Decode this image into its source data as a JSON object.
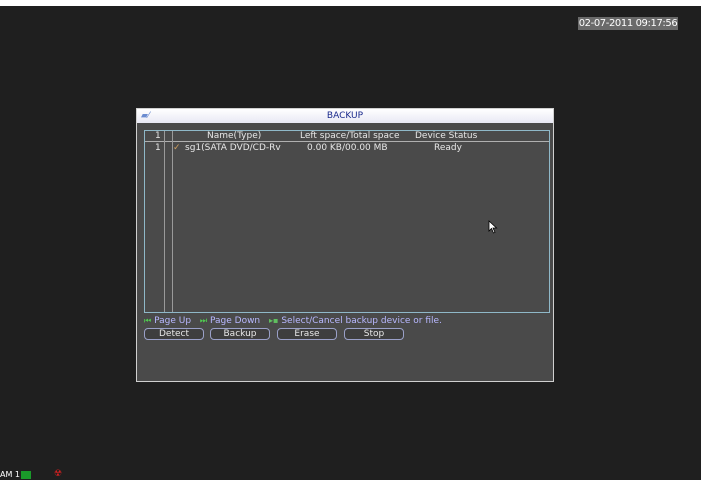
{
  "screen": {
    "datetime": "02-07-2011 09:17:56",
    "channel_label": "AM 1"
  },
  "dialog": {
    "title": "BACKUP",
    "table": {
      "headers": {
        "index": "1",
        "name": "Name(Type)",
        "space": "Left space/Total space",
        "status": "Device Status"
      },
      "rows": [
        {
          "index": "1",
          "name": "sg1(SATA DVD/CD-Rv",
          "space": "0.00 KB/00.00 MB",
          "status": "Ready"
        }
      ]
    },
    "hints": {
      "page_up": "Page Up",
      "page_down": "Page Down",
      "select": "Select/Cancel backup device or file."
    },
    "buttons": {
      "detect": "Detect",
      "backup": "Backup",
      "erase": "Erase",
      "stop": "Stop"
    }
  },
  "colors": {
    "background": "#1f1f1f",
    "dialog_bg": "#4a4a4a",
    "title_text": "#1a2a8c",
    "hint_text": "#b8b8ff",
    "status_green": "#1a9a2a",
    "alarm_red": "#d02020"
  },
  "icons": {
    "title": "backup-window-icon",
    "row_check": "checkmark-icon",
    "cursor": "mouse-pointer-icon",
    "alarm": "alarm-icon"
  }
}
